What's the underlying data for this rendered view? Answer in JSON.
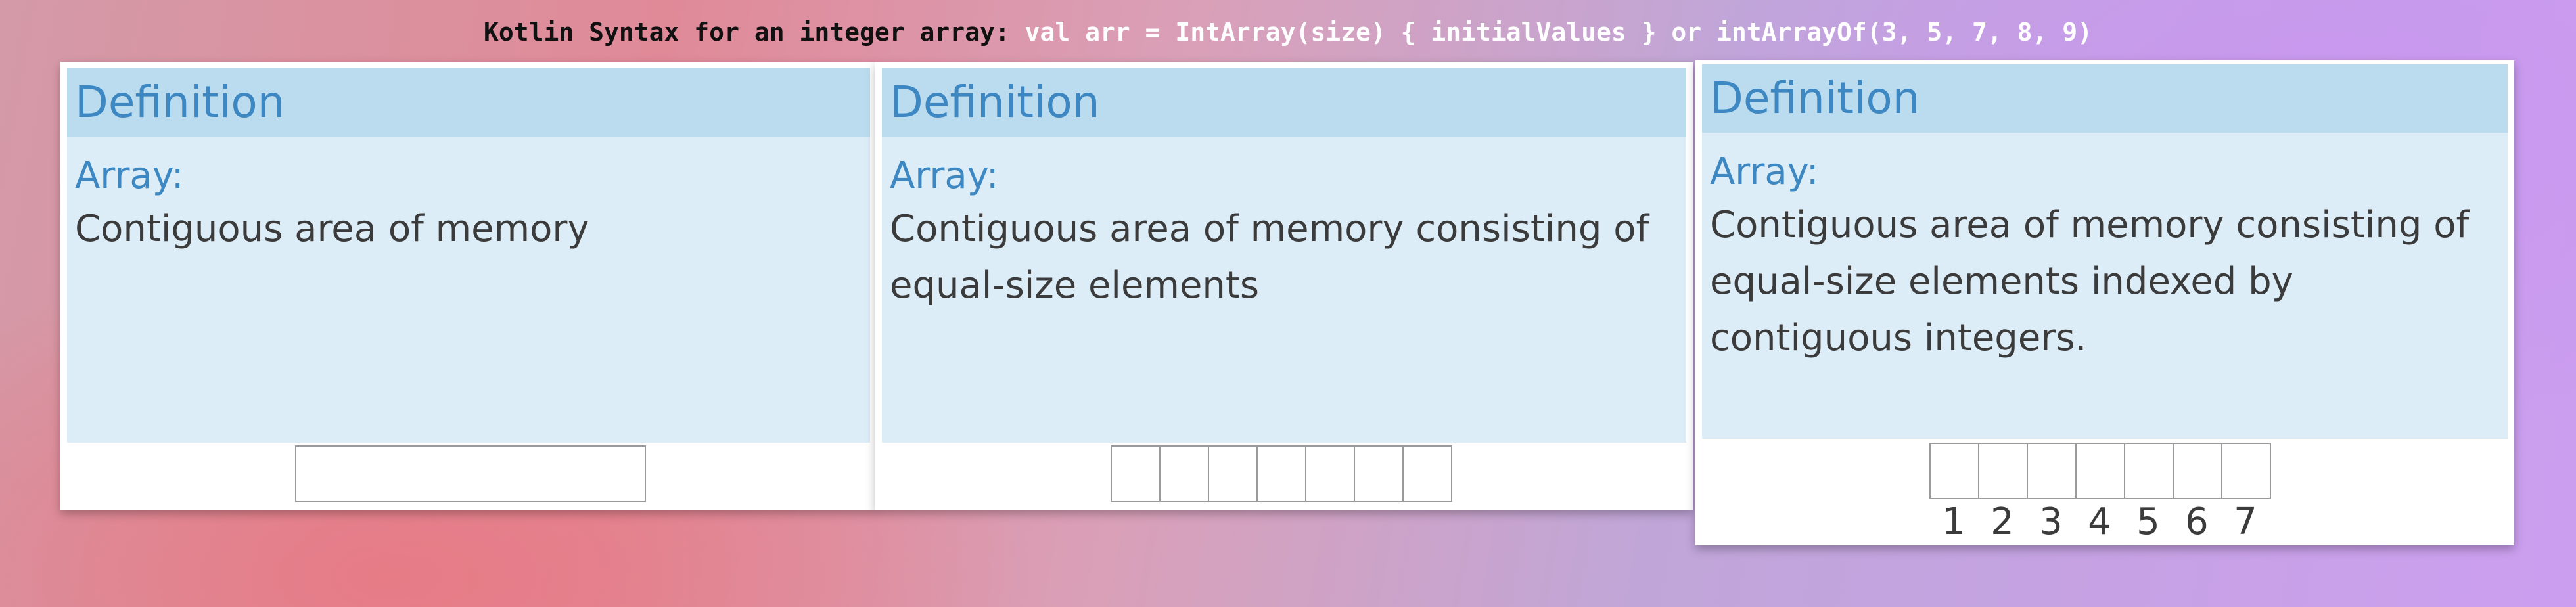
{
  "title": {
    "prefix": "Kotlin Syntax for an integer array:",
    "code": "val arr = IntArray(size) { initialValues } or intArrayOf(3, 5, 7, 8, 9)"
  },
  "slides": [
    {
      "heading": "Definition",
      "term": "Array:",
      "description": "Contiguous area of memory",
      "cells": 1
    },
    {
      "heading": "Definition",
      "term": "Array:",
      "description": "Contiguous area of memory consisting of equal-size elements",
      "cells": 7
    },
    {
      "heading": "Definition",
      "term": "Array:",
      "description": "Contiguous area of memory consisting of equal-size elements indexed by contiguous integers.",
      "cells": 7,
      "indices": [
        "1",
        "2",
        "3",
        "4",
        "5",
        "6",
        "7"
      ]
    }
  ],
  "colors": {
    "block_header": "#bbdcef",
    "block_body": "#dcedf8",
    "accent_text": "#3d88c2",
    "body_text": "#3b3b3b"
  }
}
